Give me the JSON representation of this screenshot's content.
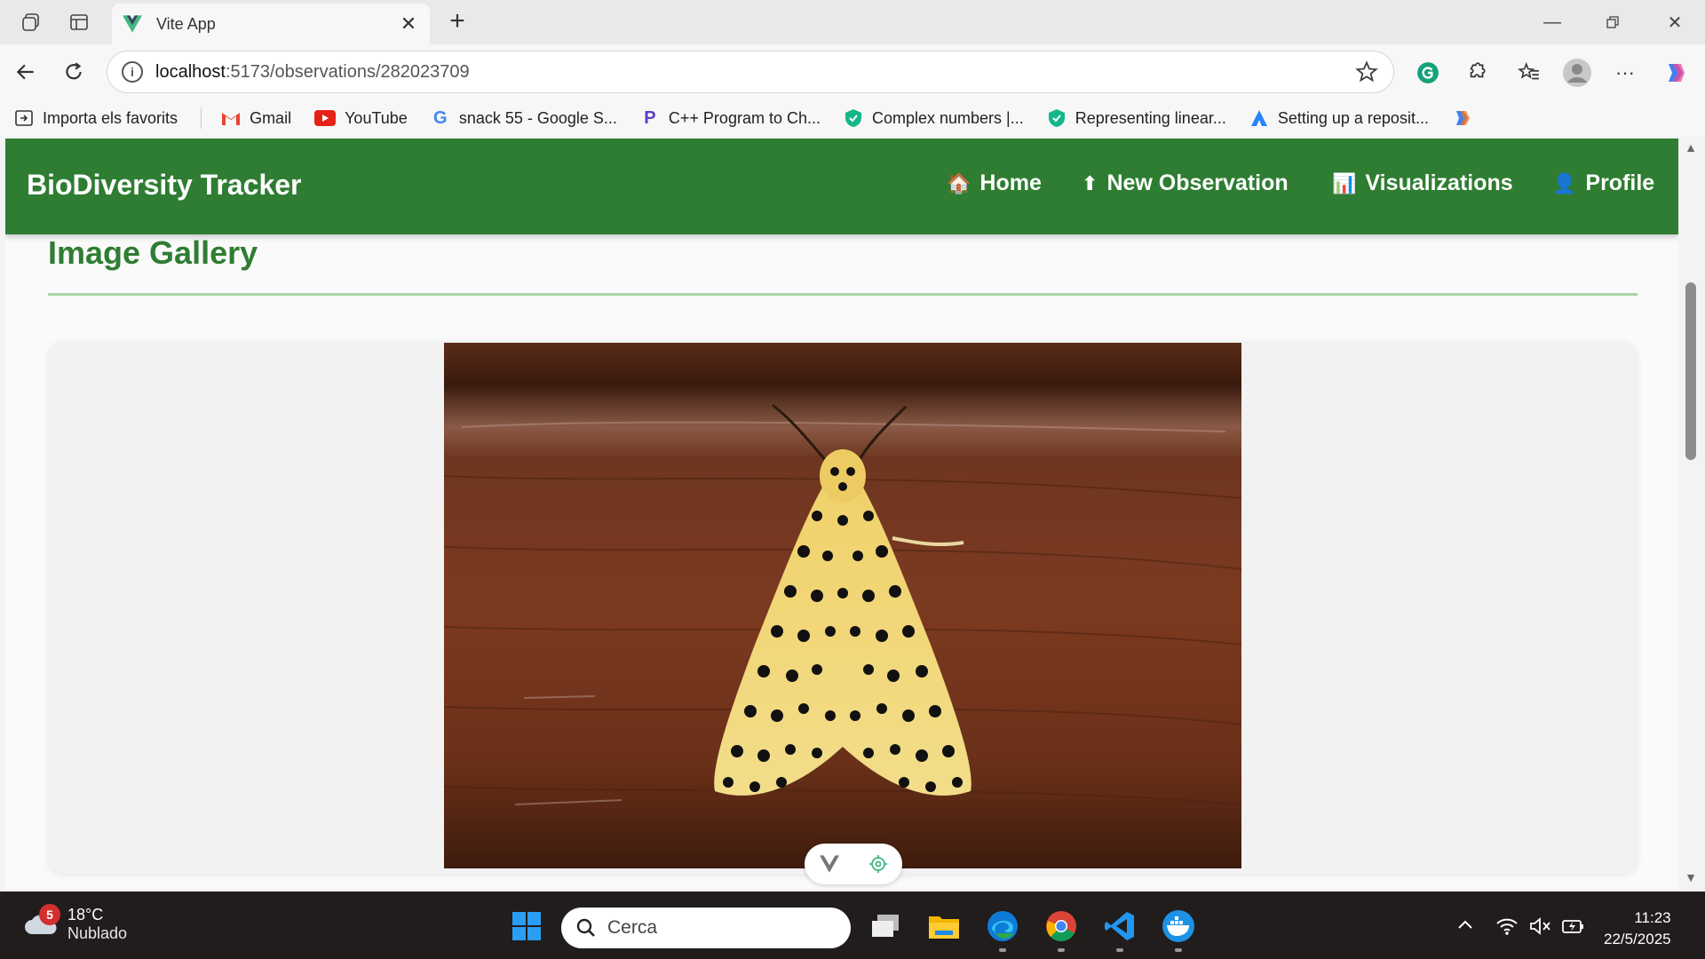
{
  "browser": {
    "tab_title": "Vite App",
    "url_host": "localhost",
    "url_path": ":5173/observations/282023709"
  },
  "bookmarks": [
    {
      "label": "Importa els favorits",
      "icon": "import-icon"
    },
    {
      "label": "Gmail",
      "icon": "gmail-icon"
    },
    {
      "label": "YouTube",
      "icon": "youtube-icon"
    },
    {
      "label": "snack 55 - Google S...",
      "icon": "google-icon"
    },
    {
      "label": "C++ Program to Ch...",
      "icon": "programiz-icon"
    },
    {
      "label": "Complex numbers |...",
      "icon": "shield-check-icon"
    },
    {
      "label": "Representing linear...",
      "icon": "shield-check-icon"
    },
    {
      "label": "Setting up a reposit...",
      "icon": "atlassian-icon"
    }
  ],
  "app": {
    "brand": "BioDiversity Tracker",
    "nav": [
      {
        "label": "Home",
        "emoji": "🏠"
      },
      {
        "label": "New Observation",
        "emoji": "⬆"
      },
      {
        "label": "Visualizations",
        "emoji": "📊"
      },
      {
        "label": "Profile",
        "emoji": "👤"
      }
    ],
    "gallery_title": "Image Gallery",
    "photo_subject": "moth-photo"
  },
  "taskbar": {
    "weather_badge": "5",
    "temperature": "18°C",
    "condition": "Nublado",
    "search_placeholder": "Cerca",
    "time": "11:23",
    "date": "22/5/2025"
  },
  "colors": {
    "app_green": "#2e7d32",
    "divider_green": "#a5d6a7"
  }
}
